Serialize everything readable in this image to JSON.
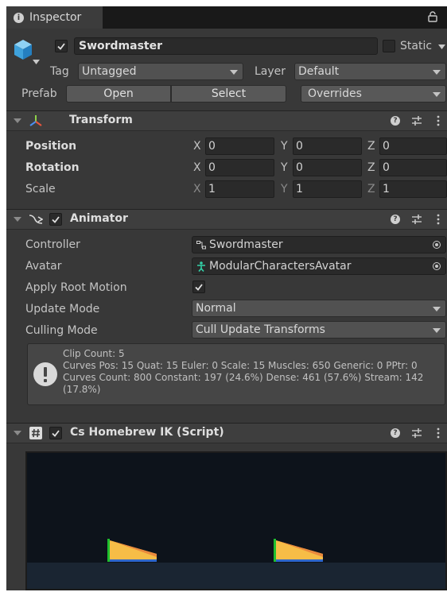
{
  "window": {
    "tab_title": "Inspector",
    "info_icon": "info-icon",
    "lock_icon": "lock-icon"
  },
  "gameobject": {
    "name": "Swordmaster",
    "active": true,
    "static_label": "Static",
    "static_checked": false,
    "tag_label": "Tag",
    "tag_value": "Untagged",
    "layer_label": "Layer",
    "layer_value": "Default",
    "prefab_label": "Prefab",
    "open_label": "Open",
    "select_label": "Select",
    "overrides_label": "Overrides"
  },
  "transform": {
    "title": "Transform",
    "rows": [
      {
        "label": "Position",
        "x": "0",
        "y": "0",
        "z": "0"
      },
      {
        "label": "Rotation",
        "x": "0",
        "y": "0",
        "z": "0"
      },
      {
        "label": "Scale",
        "x": "1",
        "y": "1",
        "z": "1"
      }
    ],
    "axes": {
      "x": "X",
      "y": "Y",
      "z": "Z"
    }
  },
  "animator": {
    "title": "Animator",
    "enabled": true,
    "controller_label": "Controller",
    "controller_value": "Swordmaster",
    "avatar_label": "Avatar",
    "avatar_value": "ModularCharactersAvatar",
    "root_motion_label": "Apply Root Motion",
    "root_motion": true,
    "update_mode_label": "Update Mode",
    "update_mode_value": "Normal",
    "culling_mode_label": "Culling Mode",
    "culling_mode_value": "Cull Update Transforms",
    "info_lines": [
      "Clip Count: 5",
      "Curves Pos: 15 Quat: 15 Euler: 0 Scale: 15 Muscles: 650 Generic: 0 PPtr: 0",
      "Curves Count: 800 Constant: 197 (24.6%) Dense: 461 (57.6%) Stream: 142",
      "(17.8%)"
    ]
  },
  "script": {
    "title": "Cs Homebrew IK (Script)",
    "enabled": true
  },
  "colors": {
    "panel": "#383838",
    "header": "#3e3e3e",
    "field": "#2a2a2a",
    "button": "#585858",
    "preview_bg": "#0d131b",
    "preview_ground": "#1a2532",
    "shape_yellow": "#f6bd47",
    "shape_orange": "#ea8a3d",
    "shape_blue": "#2f66c9",
    "shape_green": "#1fbf2e"
  }
}
